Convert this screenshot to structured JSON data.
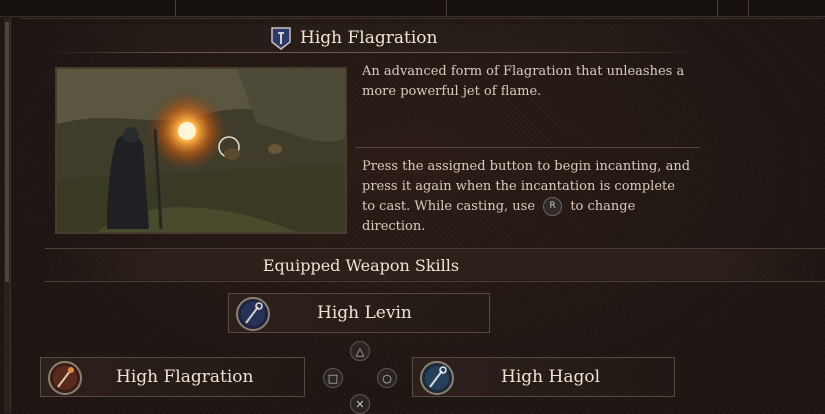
{
  "skill": {
    "name": "High Flagration",
    "description": "An advanced form of Flagration that unleashes a more powerful jet of flame.",
    "instructions_before_key": "Press the assigned button to begin incanting, and press it again when the incantation is complete to cast. While casting, use",
    "instructions_key": "R",
    "instructions_after_key": "to change direction."
  },
  "equipped": {
    "title": "Equipped Weapon Skills",
    "top_slot": "High Levin",
    "left_slot": "High Flagration",
    "right_slot": "High Hagol",
    "buttons": {
      "triangle": "△",
      "square": "□",
      "circle": "○",
      "cross": "✕"
    }
  },
  "colors": {
    "background": "#1d1512",
    "text": "#efe4d4",
    "border": "#5a4a3e"
  }
}
